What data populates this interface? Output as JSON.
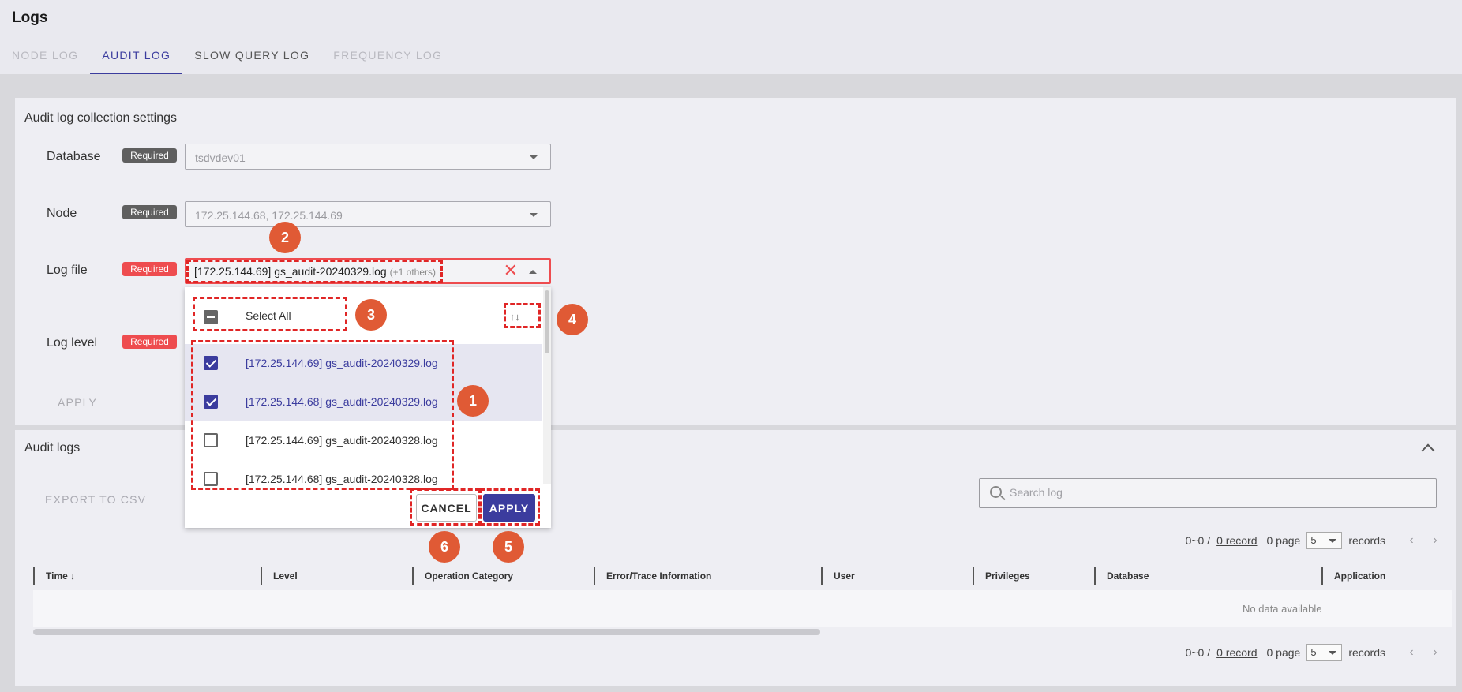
{
  "header": {
    "title": "Logs",
    "tabs": [
      {
        "label": "NODE LOG"
      },
      {
        "label": "AUDIT LOG"
      },
      {
        "label": "SLOW QUERY LOG"
      },
      {
        "label": "FREQUENCY LOG"
      }
    ]
  },
  "settings": {
    "title": "Audit log collection settings",
    "required_label": "Required",
    "database": {
      "label": "Database",
      "value": "tsdvdev01"
    },
    "node": {
      "label": "Node",
      "value": "172.25.144.68, 172.25.144.69"
    },
    "log_file": {
      "label": "Log file",
      "value": "[172.25.144.69] gs_audit-20240329.log",
      "extra": "(+1 others)"
    },
    "log_level": {
      "label": "Log level"
    },
    "apply_label": "APPLY"
  },
  "dropdown": {
    "select_all_label": "Select All",
    "items": [
      {
        "label": "[172.25.144.69] gs_audit-20240329.log",
        "checked": true
      },
      {
        "label": "[172.25.144.68] gs_audit-20240329.log",
        "checked": true
      },
      {
        "label": "[172.25.144.69] gs_audit-20240328.log",
        "checked": false
      },
      {
        "label": "[172.25.144.68] gs_audit-20240328.log",
        "checked": false
      }
    ],
    "cancel_label": "CANCEL",
    "apply_label": "APPLY"
  },
  "logs": {
    "title": "Audit logs",
    "export_label": "EXPORT TO CSV",
    "search_placeholder": "Search log",
    "pager": {
      "range": "0~0 /",
      "record": "0 record",
      "page": "0 page",
      "page_size": "5",
      "records": "records"
    },
    "columns": [
      "Time",
      "Level",
      "Operation Category",
      "Error/Trace Information",
      "User",
      "Privileges",
      "Database",
      "Application"
    ],
    "time_sort_glyph": "↓",
    "empty_text": "No data available"
  },
  "annotations": [
    "1",
    "2",
    "3",
    "4",
    "5",
    "6"
  ],
  "colors": {
    "accent": "#3b3c9e",
    "error": "#ee4c4f",
    "annotation": "#e02626",
    "callout": "#e05a35"
  }
}
